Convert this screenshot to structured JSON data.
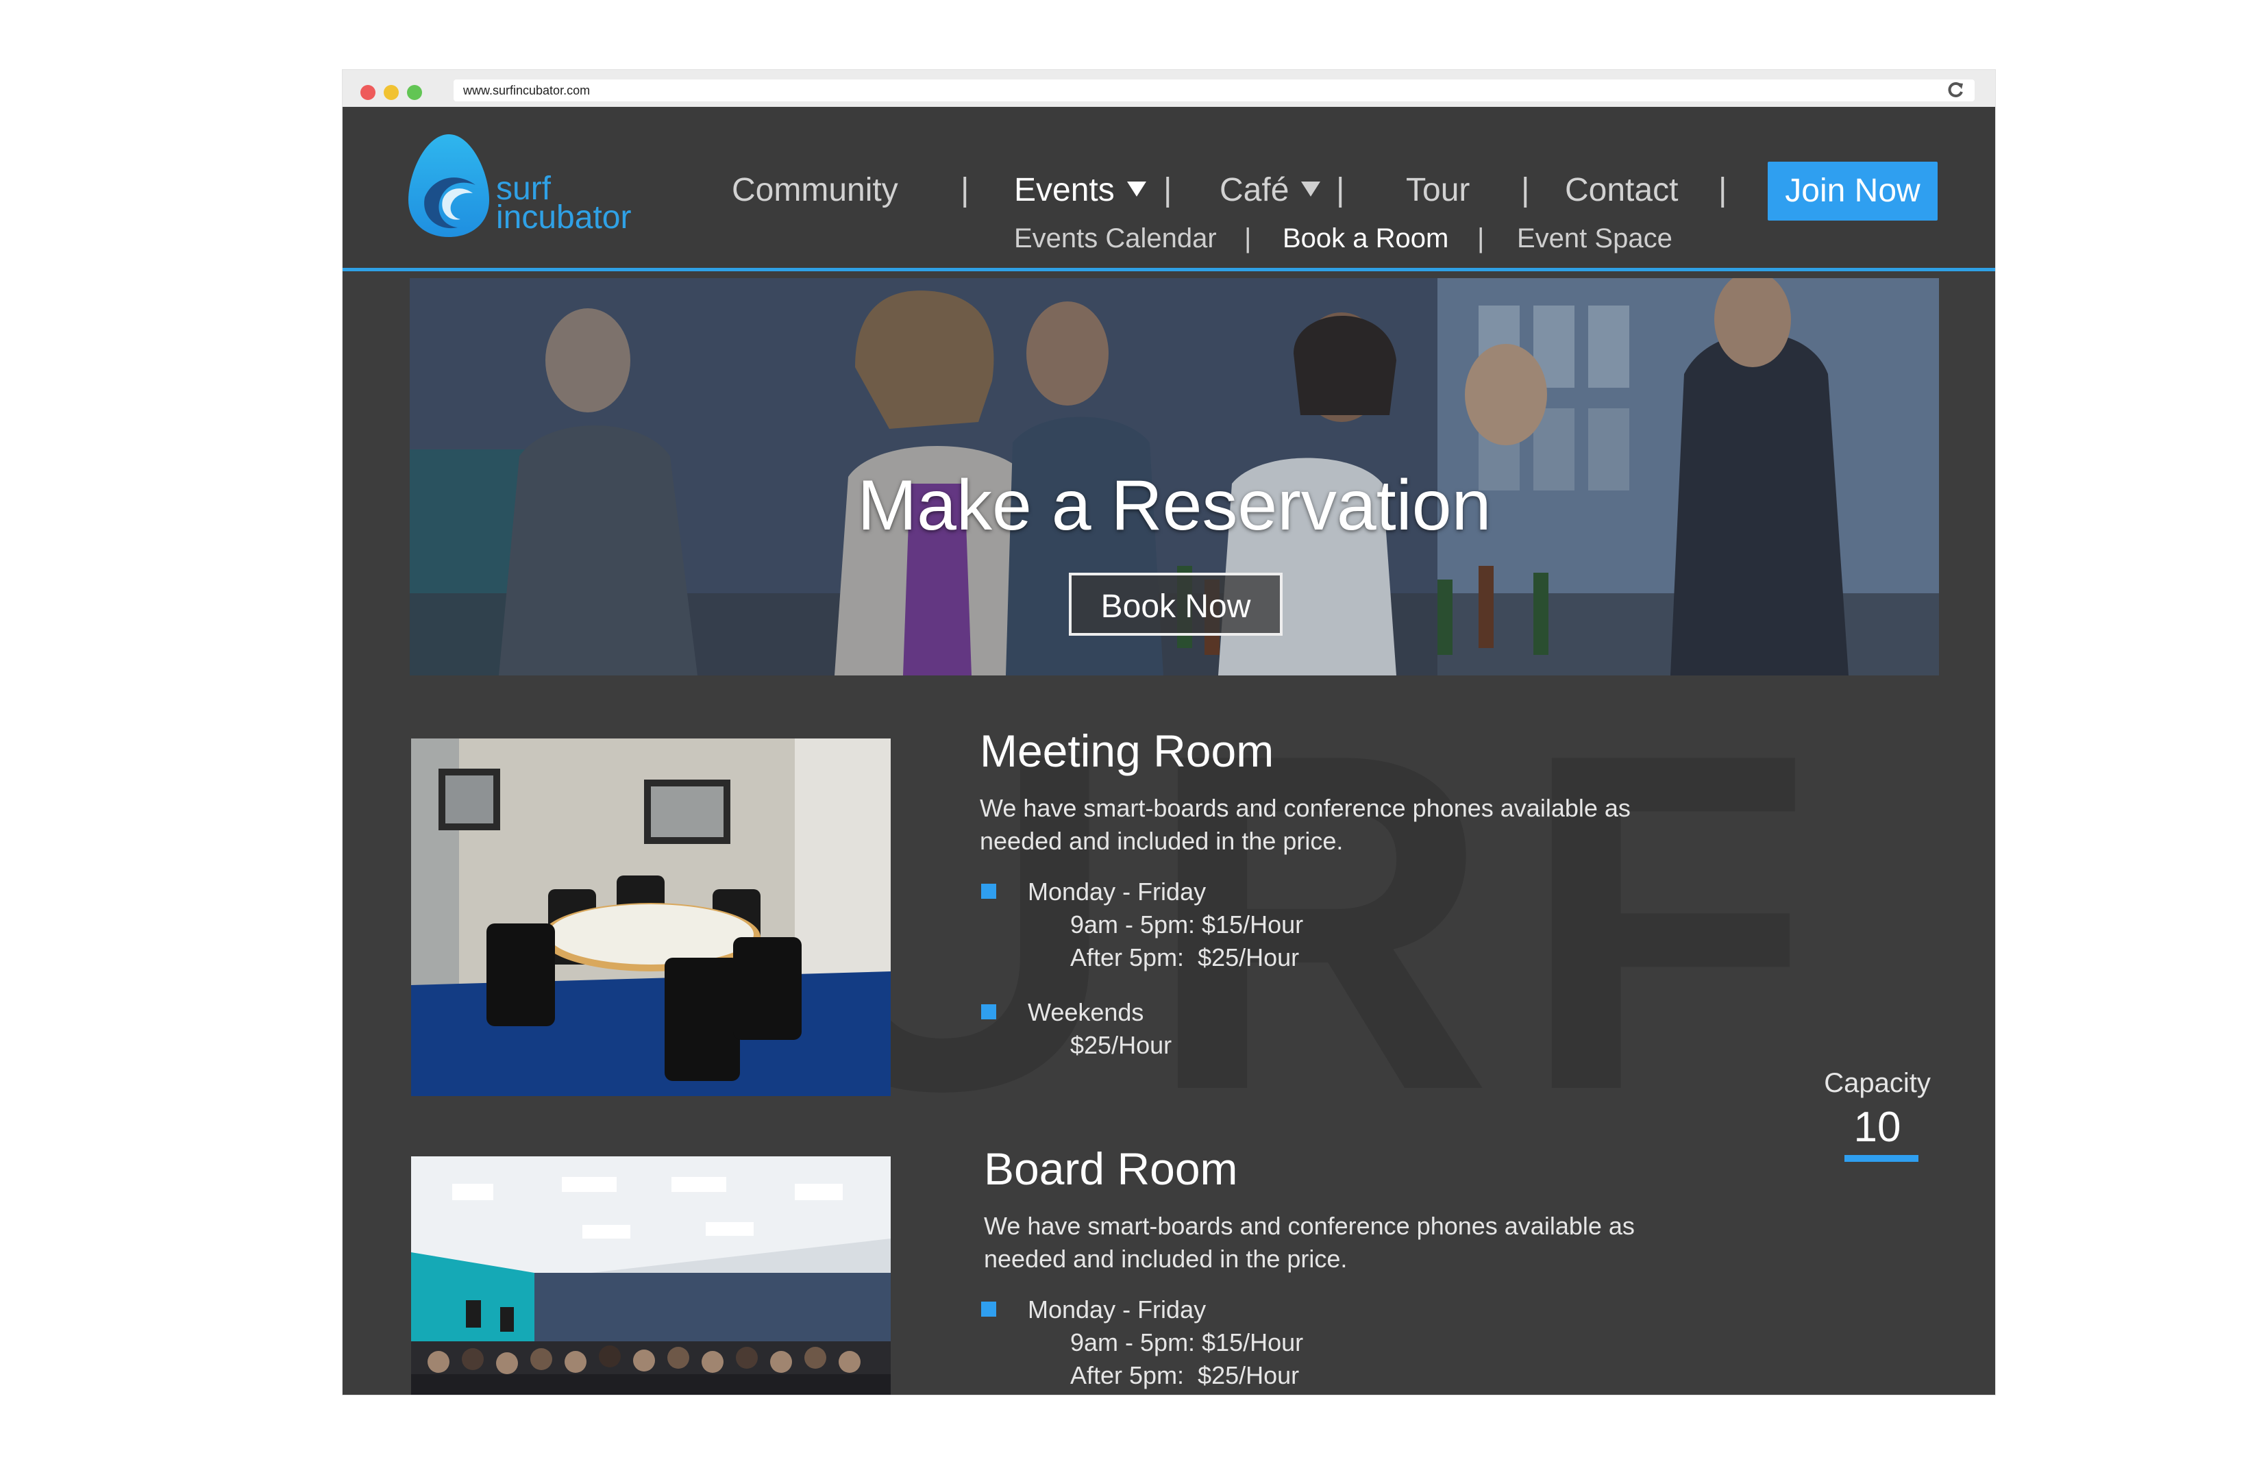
{
  "browser": {
    "url": "www.surfincubator.com"
  },
  "logo": {
    "line1": "surf",
    "line2": "incubator"
  },
  "nav": {
    "items": [
      {
        "label": "Community"
      },
      {
        "label": "Events"
      },
      {
        "label": "Café"
      },
      {
        "label": "Tour"
      },
      {
        "label": "Contact"
      }
    ],
    "separator": "|",
    "join_label": "Join Now",
    "sub_items": [
      {
        "label": "Events Calendar"
      },
      {
        "label": "Book a Room"
      },
      {
        "label": "Event Space"
      }
    ]
  },
  "hero": {
    "title": "Make a Reservation",
    "button_label": "Book Now"
  },
  "watermark": "SURF",
  "rooms": [
    {
      "title": "Meeting Room",
      "description": "We have smart-boards and conference phones available as needed and included in the price.",
      "weekday_label": "Monday - Friday",
      "weekday_rate_1": "9am - 5pm: $15/Hour",
      "weekday_rate_2": "After 5pm:  $25/Hour",
      "weekend_label": "Weekends",
      "weekend_rate": "$25/Hour",
      "capacity_label": "Capacity",
      "capacity_value": "10"
    },
    {
      "title": "Board Room",
      "description": "We have smart-boards and conference phones available as needed and included in the price.",
      "weekday_label": "Monday - Friday",
      "weekday_rate_1": "9am - 5pm: $15/Hour",
      "weekday_rate_2": "After 5pm:  $25/Hour"
    }
  ],
  "colors": {
    "accent": "#2f9ff0",
    "page_background": "#3d3d3d",
    "header_background": "#3b3b3b",
    "text": "#e6e6e6"
  },
  "icons": {
    "reload": "reload-icon",
    "logo": "surf-egg-logo-icon",
    "dropdown": "caret-down-icon",
    "bullet": "square-bullet-icon"
  }
}
